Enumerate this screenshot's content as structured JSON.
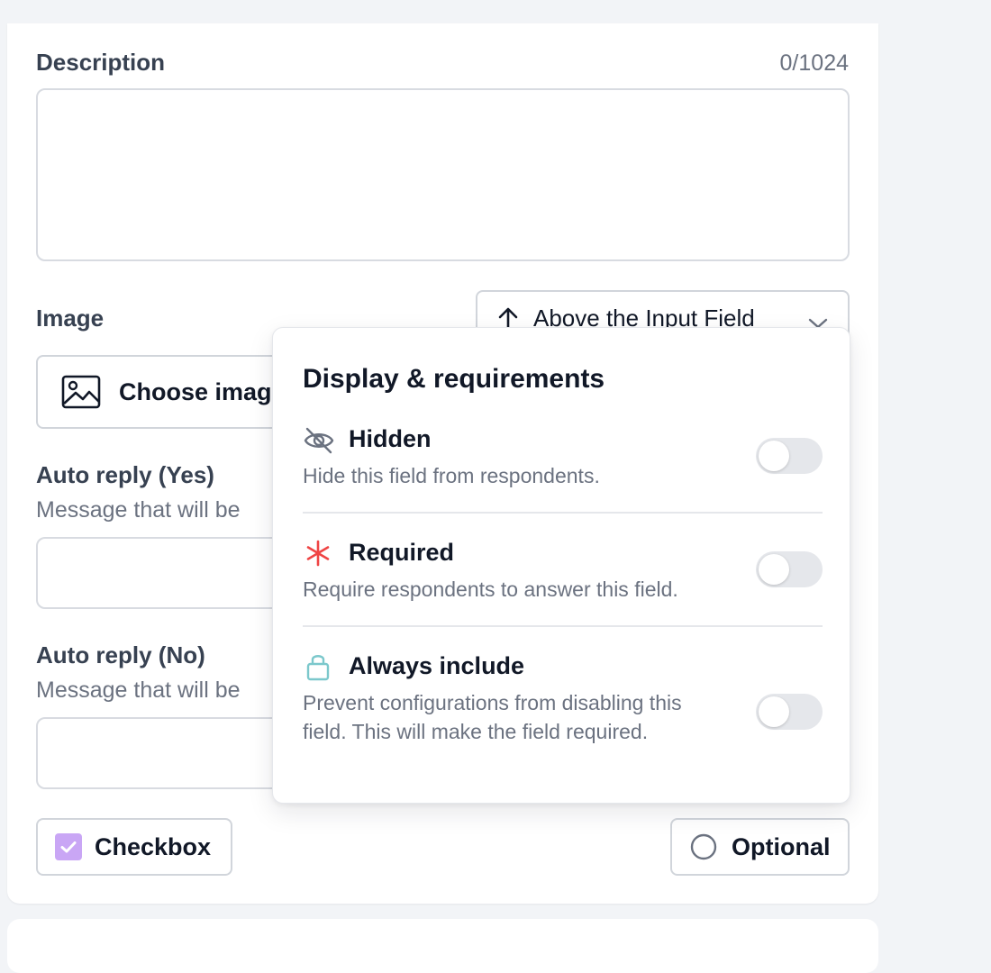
{
  "description": {
    "label": "Description",
    "counter": "0/1024",
    "value": ""
  },
  "image": {
    "label": "Image",
    "position_select": {
      "icon": "arrow-up-icon",
      "value": "Above the Input Field"
    },
    "choose_button": {
      "icon": "image-icon",
      "label": "Choose image"
    }
  },
  "auto_reply_yes": {
    "label": "Auto reply (Yes)",
    "hint": "Message that will be",
    "value": ""
  },
  "auto_reply_no": {
    "label": "Auto reply (No)",
    "hint": "Message that will be",
    "value": ""
  },
  "footer": {
    "type_button": {
      "label": "Checkbox",
      "checked": true,
      "accent": "#c9a6f5"
    },
    "optional_button": {
      "label": "Optional"
    }
  },
  "popover": {
    "title": "Display & requirements",
    "options": [
      {
        "key": "hidden",
        "icon": "eye-off-icon",
        "title": "Hidden",
        "description": "Hide this field from respondents.",
        "enabled": false,
        "icon_color": "#6b7280"
      },
      {
        "key": "required",
        "icon": "asterisk-icon",
        "title": "Required",
        "description": "Require respondents to answer this field.",
        "enabled": false,
        "icon_color": "#ef4444"
      },
      {
        "key": "always_include",
        "icon": "lock-icon",
        "title": "Always include",
        "description": "Prevent configurations from disabling this field. This will make the field required.",
        "enabled": false,
        "icon_color": "#7cc8cc"
      }
    ]
  }
}
